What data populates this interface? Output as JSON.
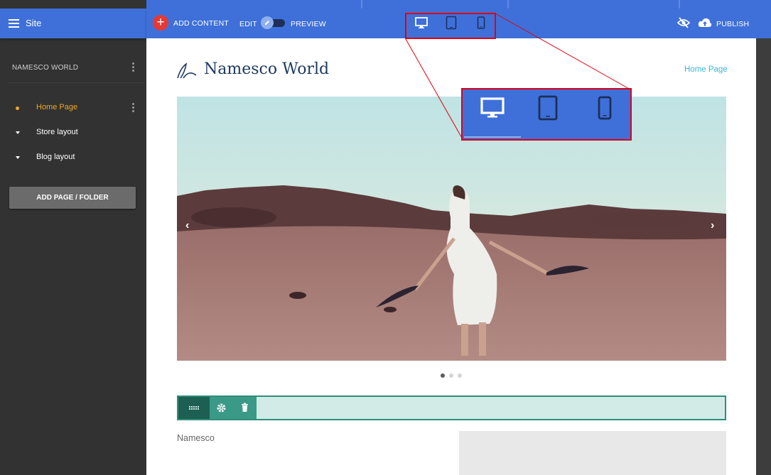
{
  "sidebar": {
    "title": "Site",
    "site_name": "NAMESCO WORLD",
    "pages": [
      {
        "label": "Home Page",
        "active": true
      },
      {
        "label": "Store layout"
      },
      {
        "label": "Blog layout"
      }
    ],
    "add_button": "ADD PAGE / FOLDER"
  },
  "toolbar": {
    "add_content": "ADD CONTENT",
    "edit": "EDIT",
    "preview": "PREVIEW",
    "publish": "PUBLISH",
    "devices": [
      "desktop-icon",
      "tablet-icon",
      "phone-icon"
    ]
  },
  "website": {
    "brand": "Namesco World",
    "nav_link": "Home Page",
    "body_text": "Namesco",
    "slider_dots": 3,
    "active_slide": 1
  },
  "colors": {
    "accent_blue": "#3f70d9",
    "sidebar": "#323232",
    "active_orange": "#f3a623",
    "add_red": "#e53935",
    "link_blue": "#3db5d6",
    "row_teal": "#2e8e7c",
    "highlight_red": "#e00010"
  }
}
